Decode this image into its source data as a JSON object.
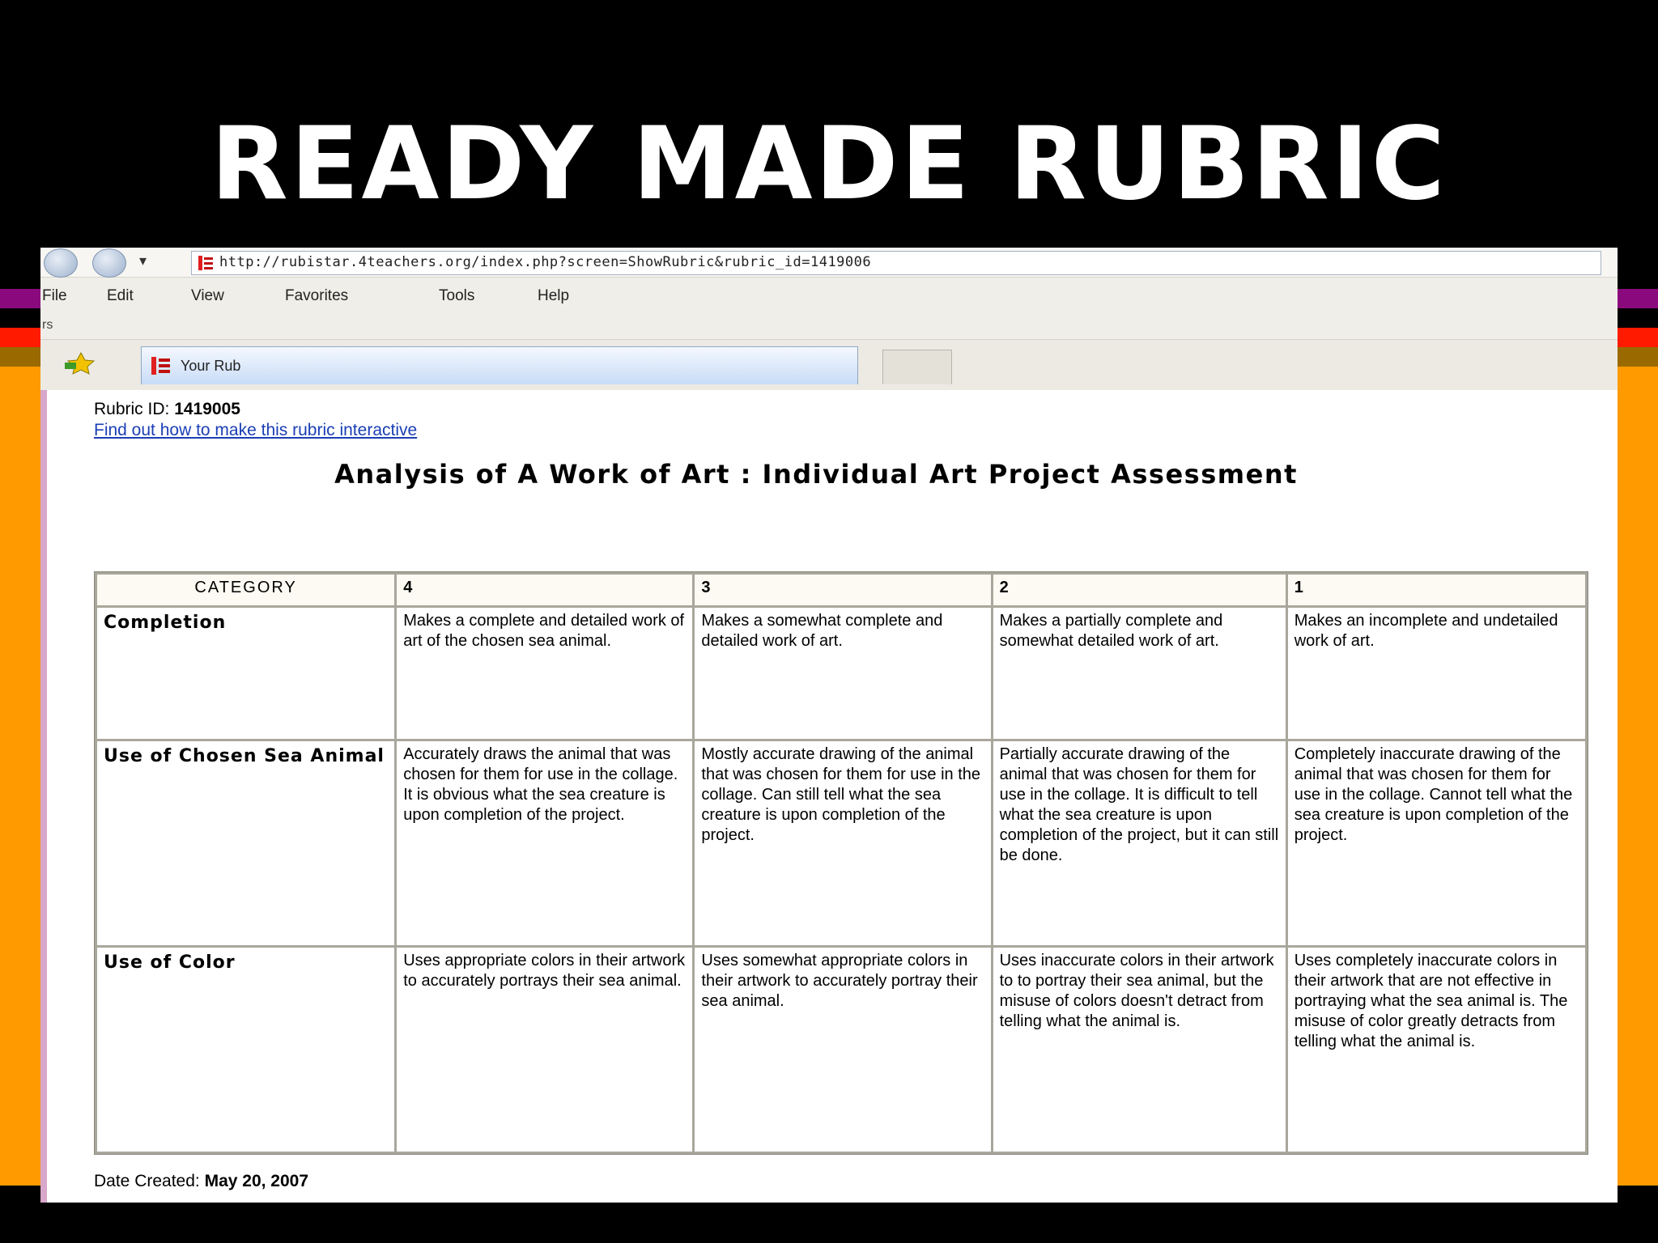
{
  "slide": {
    "title": "READY MADE RUBRIC"
  },
  "browser": {
    "address": "http://rubistar.4teachers.org/index.php?screen=ShowRubric&rubric_id=1419006",
    "menu": [
      "File",
      "Edit",
      "View",
      "Favorites",
      "Tools",
      "Help"
    ],
    "menu_sub": "rs",
    "tab_label": "Your Rub"
  },
  "page": {
    "rubric_id_label": "Rubric ID:",
    "rubric_id": "1419005",
    "interactive_link": "Find out how to make this rubric interactive",
    "title": "Analysis of A Work of Art : Individual Art Project Assessment",
    "date_label": "Date Created:",
    "date_value": "May 20, 2007"
  },
  "rubric": {
    "headers": [
      "CATEGORY",
      "4",
      "3",
      "2",
      "1"
    ],
    "rows": [
      {
        "category": "Completion",
        "cells": [
          "Makes a complete and detailed work of art of the chosen sea animal.",
          "Makes a somewhat complete and detailed work of art.",
          "Makes a partially complete and somewhat detailed work of art.",
          "Makes an incomplete and undetailed work of art."
        ]
      },
      {
        "category": "Use of Chosen Sea Animal",
        "cells": [
          "Accurately draws the animal that was chosen for them for use in the collage. It is obvious what the sea creature is upon completion of the project.",
          "Mostly accurate drawing of the animal that was chosen for them for use in the collage. Can still tell what the sea creature is upon completion of the project.",
          "Partially accurate drawing of the animal that was chosen for them for use in the collage. It is difficult to tell what the sea creature is upon completion of the project, but it can still be done.",
          "Completely inaccurate drawing of the animal that was chosen for them for use in the collage. Cannot tell what the sea creature is upon completion of the project."
        ]
      },
      {
        "category": "Use of Color",
        "cells": [
          "Uses appropriate colors in their artwork to accurately portrays their sea animal.",
          "Uses somewhat appropriate colors in their artwork to accurately portray their sea animal.",
          "Uses inaccurate colors in their artwork to to portray their sea animal, but the misuse of colors doesn't detract from telling what the animal is.",
          "Uses completely inaccurate colors in their artwork that are not effective in portraying what the sea animal is. The misuse of color greatly detracts from telling what the animal is."
        ]
      }
    ]
  },
  "colors": {
    "slide_background": "#000000",
    "stripe_orange": "#ff9900",
    "stripe_red": "#ff0000",
    "stripe_purple": "#800080",
    "stripe_brown": "#996600",
    "link_blue": "#1a3fb5"
  }
}
